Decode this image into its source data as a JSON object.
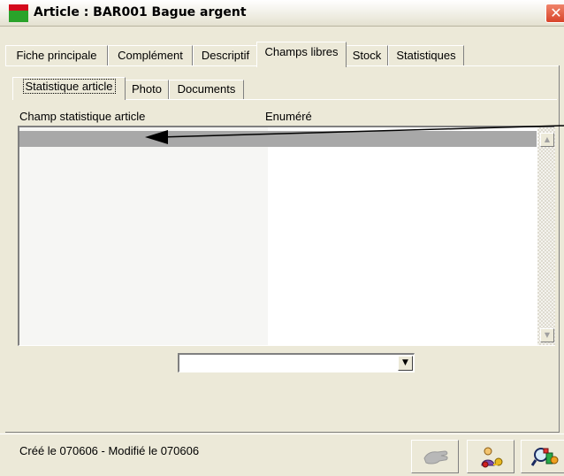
{
  "window": {
    "title": "Article : BAR001 Bague argent",
    "close_glyph": "✕"
  },
  "main_tabs": [
    {
      "label": "Fiche principale"
    },
    {
      "label": "Complément"
    },
    {
      "label": "Descriptif"
    },
    {
      "label": "Champs libres",
      "active": true
    },
    {
      "label": "Stock"
    },
    {
      "label": "Statistiques"
    }
  ],
  "sub_tabs": [
    {
      "label": "Statistique article",
      "active": true
    },
    {
      "label": "Photo"
    },
    {
      "label": "Documents"
    }
  ],
  "list": {
    "columns": [
      "Champ statistique article",
      "Enuméré"
    ],
    "scroll_up_glyph": "▲",
    "scroll_down_glyph": "▼"
  },
  "dropdown": {
    "value": "",
    "arrow_glyph": "▼"
  },
  "status": {
    "text": "Créé le 070606 - Modifié le 070606"
  },
  "toolbar": {
    "buttons": [
      {
        "icon": "disabled-hand-icon"
      },
      {
        "icon": "user-keys-icon"
      },
      {
        "icon": "search-objects-icon"
      }
    ]
  },
  "colors": {
    "window_bg": "#ece9d8",
    "selected_row": "#a8a8a8",
    "left_column_bg": "#f6f6f4"
  }
}
